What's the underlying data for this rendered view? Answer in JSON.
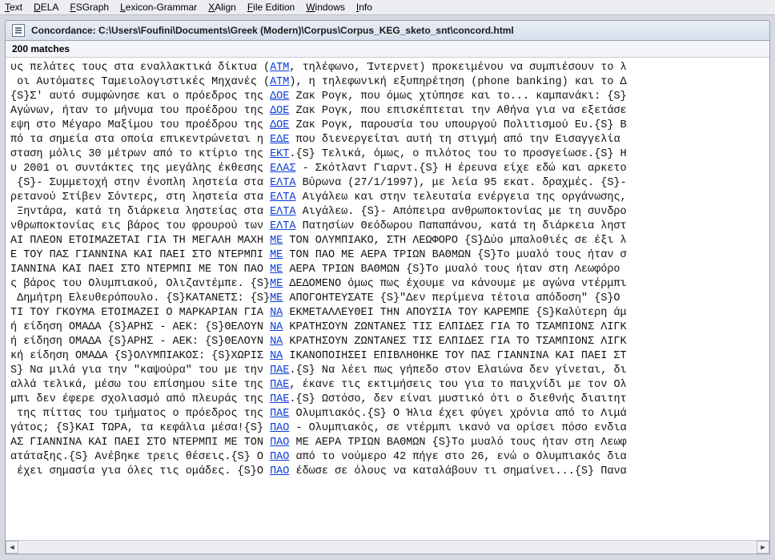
{
  "menubar": {
    "items": [
      "Text",
      "DELA",
      "FSGraph",
      "Lexicon-Grammar",
      "XAlign",
      "File Edition",
      "Windows",
      "Info"
    ],
    "mnemonics": [
      0,
      0,
      0,
      0,
      0,
      0,
      0,
      0
    ]
  },
  "window": {
    "title": "Concordance: C:\\Users\\Foufini\\Documents\\Greek (Modern)\\Corpus\\Corpus_KEG_sketo_snt\\concord.html"
  },
  "match_count_label": "200 matches",
  "concordance": {
    "rows": [
      {
        "left": "υς πελάτες τους στα εναλλακτικά δίκτυα (",
        "kw": "ΑΤΜ",
        "right": ", τηλέφωνο, Ίντερνετ) προκειμένου να συμπιέσουν το λ"
      },
      {
        "left": "οι Αυτόματες Ταμειολογιστικές Μηχανές (",
        "kw": "ΑΤΜ",
        "right": "), η τηλεφωνική εξυπηρέτηση (phone banking) και το Δ"
      },
      {
        "left": "{S}Σ' αυτό συμφώνησε και ο πρόεδρος της ",
        "kw": "ΔΟΕ",
        "right": " Ζακ Ρογκ, που όμως χτύπησε και το... καμπανάκι: {S}"
      },
      {
        "left": "Αγώνων, ήταν το μήνυμα του προέδρου της ",
        "kw": "ΔΟΕ",
        "right": " Ζακ Ρογκ, που επισκέπτεται την Αθήνα για να εξετάσε"
      },
      {
        "left": "εψη στο Μέγαρο Μαξίμου του προέδρου της ",
        "kw": "ΔΟΕ",
        "right": " Ζακ Ρογκ, παρουσία του υπουργού Πολιτισμού Ευ.{S} Β"
      },
      {
        "left": "πό τα σημεία στα οποία επικεντρώνεται η ",
        "kw": "ΕΔΕ",
        "right": " που διενεργείται αυτή τη στιγμή από την Εισαγγελία"
      },
      {
        "left": "σταση μόλις 30 μέτρων από το κτίριο της ",
        "kw": "ΕΚΤ",
        "right": ".{S} Τελικά, όμως, ο πιλότος του το προσγείωσε.{S} Η"
      },
      {
        "left": "υ 2001 οι συντάκτες της μεγάλης έκθεσης ",
        "kw": "ΕΛΑΣ",
        "right": " - Σκότλαντ Γιαρντ.{S} Η έρευνα είχε εδώ και αρκετο"
      },
      {
        "left": "{S}- Συμμετοχή στην ένοπλη ληστεία στα ",
        "kw": "ΕΛΤΑ",
        "right": " Βύρωνα (27/1/1997), με λεία 95 εκατ. δραχμές. {S}-"
      },
      {
        "left": "ρετανού Στίβεν Σόντερς, στη ληστεία στα ",
        "kw": "ΕΛΤΑ",
        "right": " Αιγάλεω και στην τελευταία ενέργεια της οργάνωσης,"
      },
      {
        "left": " Ξηντάρα, κατά τη διάρκεια ληστείας στα ",
        "kw": "ΕΛΤΑ",
        "right": " Αιγάλεω. {S}- Απόπειρα ανθρωποκτονίας με τη συνδρο"
      },
      {
        "left": "νθρωποκτονίας εις βάρος του φρουρού των ",
        "kw": "ΕΛΤΑ",
        "right": " Πατησίων Θεόδωρου Παπαπάνου, κατά τη διάρκεια ληστ"
      },
      {
        "left": "ΑΙ ΠΛΕΟΝ ΕΤΟΙΜΑΖΕΤΑΙ ΓΙΑ ΤΗ ΜΕΓΑΛΗ ΜΑΧΗ ",
        "kw": "ΜΕ",
        "right": " ΤΟΝ ΟΛΥΜΠΙΑΚΟ, ΣΤΗ ΛΕΩΦΟΡΟ {S}Δύο μπαλοθιές σε έξι λ"
      },
      {
        "left": "Ε ΤΟΥ ΠΑΣ ΓΙΑΝΝΙΝΑ ΚΑΙ ΠΑΕΙ ΣΤΟ ΝΤΕΡΜΠΙ ",
        "kw": "ΜΕ",
        "right": " ΤΟΝ ΠΑΟ ΜΕ ΑΕΡΑ ΤΡΙΩΝ ΒΑΘΜΩΝ {S}Το μυαλό τους ήταν σ"
      },
      {
        "left": "ΙΑΝΝΙΝΑ ΚΑΙ ΠΑΕΙ ΣΤΟ ΝΤΕΡΜΠΙ ΜΕ ΤΟΝ ΠΑΟ ",
        "kw": "ΜΕ",
        "right": " ΑΕΡΑ ΤΡΙΩΝ ΒΑΘΜΩΝ {S}Το μυαλό τους ήταν στη Λεωφόρο"
      },
      {
        "left": "ς βάρος του Ολυμπιακού, Ολιζαντέμπε. {S}",
        "kw": "ΜΕ",
        "right": " ΔΕΔΟΜΕΝΟ όμως πως έχουμε να κάνουμε με αγώνα ντέρμπι"
      },
      {
        "left": " Δημήτρη Ελευθερόπουλο. {S}ΚΑΤΑΝΕΤΣ: {S}",
        "kw": "ΜΕ",
        "right": " ΑΠΟΓΟΗΤΕΥΣΑΤΕ {S}\"Δεν περίμενα τέτοια απόδοση\" {S}Ο"
      },
      {
        "left": "ΤΙ ΤΟΥ ΓΚΟΥΜΑ ΕΤΟΙΜΑΖΕΙ Ο ΜΑΡΚΑΡΙΑΝ ΓΙΑ ",
        "kw": "ΝΑ",
        "right": " ΕΚΜΕΤΑΛΛΕΥΘΕΙ ΤΗΝ ΑΠΟΥΣΙΑ ΤΟΥ ΚΑΡΕΜΠΕ {S}Καλύτερη άμ"
      },
      {
        "left": "ή είδηση ΟΜΑΔΑ {S}ΑΡΗΣ - ΑΕΚ: {S}ΘΕΛΟΥΝ ",
        "kw": "ΝΑ",
        "right": " ΚΡΑΤΗΣΟΥΝ ΖΩΝΤΑΝΕΣ ΤΙΣ ΕΛΠΙΔΕΣ ΓΙΑ ΤΟ ΤΣΑΜΠΙΟΝΣ ΛΙΓΚ"
      },
      {
        "left": "ή είδηση ΟΜΑΔΑ {S}ΑΡΗΣ - ΑΕΚ: {S}ΘΕΛΟΥΝ ",
        "kw": "ΝΑ",
        "right": " ΚΡΑΤΗΣΟΥΝ ΖΩΝΤΑΝΕΣ ΤΙΣ ΕΛΠΙΔΕΣ ΓΙΑ ΤΟ ΤΣΑΜΠΙΟΝΣ ΛΙΓΚ"
      },
      {
        "left": "κή είδηση ΟΜΑΔΑ {S}ΟΛΥΜΠΙΑΚΟΣ: {S}ΧΩΡΙΣ ",
        "kw": "ΝΑ",
        "right": " ΙΚΑΝΟΠΟΙΗΣΕΙ ΕΠΙΒΛΗΘΗΚΕ ΤΟΥ ΠΑΣ ΓΙΑΝΝΙΝΑ ΚΑΙ ΠΑΕΙ ΣΤ"
      },
      {
        "left": "S} Να μιλά για την \"καψούρα\" του με την ",
        "kw": "ΠΑΕ",
        "right": ".{S} Να λέει πως γήπεδο στον Ελαιώνα δεν γίνεται, δι"
      },
      {
        "left": "αλλά τελικά, μέσω του επίσημου site της ",
        "kw": "ΠΑΕ",
        "right": ", έκανε τις εκτιμήσεις του για το παιχνίδι με τον Ολ"
      },
      {
        "left": "μπι δεν έφερε σχολιασμό από πλευράς της ",
        "kw": "ΠΑΕ",
        "right": ".{S} Ωστόσο, δεν είναι μυστικό ότι ο διεθνής διαιτητ"
      },
      {
        "left": "της πίττας του τμήματος ο πρόεδρος της ",
        "kw": "ΠΑΕ",
        "right": " Ολυμπιακός.{S} Ο Ήλια έχει φύγει χρόνια από το Λιμά"
      },
      {
        "left": "γάτος; {S}ΚΑΙ ΤΩΡΑ, τα κεφάλια μέσα!{S} ",
        "kw": "ΠΑΟ",
        "right": " - Ολυμπιακός, σε ντέρμπι ικανό να ορίσει πόσο ενδια"
      },
      {
        "left": "ΑΣ ΓΙΑΝΝΙΝΑ ΚΑΙ ΠΑΕΙ ΣΤΟ ΝΤΕΡΜΠΙ ΜΕ ΤΟΝ ",
        "kw": "ΠΑΟ",
        "right": " ΜΕ ΑΕΡΑ ΤΡΙΩΝ ΒΑΘΜΩΝ {S}Το μυαλό τους ήταν στη Λεωφ"
      },
      {
        "left": "ατάταξης.{S} Ανέβηκε τρεις θέσεις.{S} Ο ",
        "kw": "ΠΑΟ",
        "right": " από το νούμερο 42 πήγε στο 26, ενώ ο Ολυμπιακός δια"
      },
      {
        "left": "έχει σημασία για όλες τις ομάδες. {S}Ο ",
        "kw": "ΠΑΟ",
        "right": " έδωσε σε όλους να καταλάβουν τι σημαίνει...{S} Πανα"
      }
    ]
  },
  "scroll": {
    "left_arrow": "◄",
    "right_arrow": "►"
  }
}
